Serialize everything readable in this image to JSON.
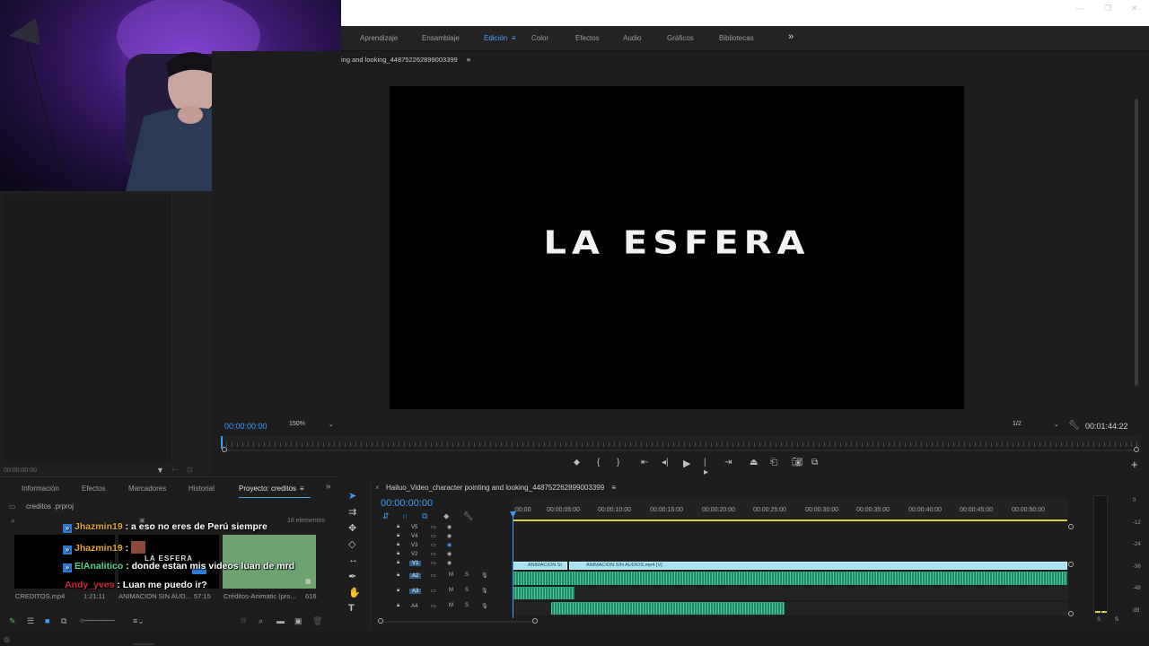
{
  "workspaces": {
    "items": [
      "Aprendizaje",
      "Ensamblaje",
      "Edición",
      "Color",
      "Efectos",
      "Audio",
      "Gráficos",
      "Bibliotecas"
    ],
    "active": "Edición",
    "more": "»"
  },
  "program": {
    "sequence_title": "ing and looking_448752262899003399",
    "menu_icon": "≡",
    "title_text": "LA ESFERA",
    "timecode": "00:00:00:00",
    "zoom": "150%",
    "resolution": "1/2",
    "duration": "00:01:44:22"
  },
  "source": {
    "timecode": "00:00:00:00"
  },
  "project_panel": {
    "tabs": [
      "Información",
      "Efectos",
      "Marcadores",
      "Historial",
      "Proyecto: creditos"
    ],
    "active_tab": "Proyecto: creditos",
    "file": "creditos .prproj",
    "item_count": "18 elementos",
    "items": [
      {
        "name": "CREDITOS.mp4",
        "duration": "1:21:11"
      },
      {
        "name": "ANIMACION SIN AUD...",
        "duration": "57:15"
      },
      {
        "name": "Créditos-Animatic (pro...",
        "duration": "616"
      }
    ],
    "thumb_text": "LA ESFERA"
  },
  "chat": [
    {
      "user": "Jhazmin19",
      "message": "a eso no eres de Perú siempre",
      "color": "#e6a632"
    },
    {
      "user": "Jhazmin19",
      "message": "",
      "color": "#e6a632"
    },
    {
      "user": "ElAnalitico",
      "message": "donde estan mis videos luan de mrd",
      "color": "#5ed18a"
    },
    {
      "user": "Andy_yves",
      "message": "Luan me puedo ir?",
      "color": "#d0283a"
    }
  ],
  "timeline": {
    "sequence_title": "Hailuo_Video_character pointing and looking_448752262899003399",
    "menu_icon": "≡",
    "timecode": "00:00:00:00",
    "ruler_labels": [
      ":00:00",
      "00:00:05:00",
      "00:00:10:00",
      "00:00:15:00",
      "00:00:20:00",
      "00:00:25:00",
      "00:00:30:00",
      "00:00:35:00",
      "00:00:40:00",
      "00:00:45:00",
      "00:00:50:00"
    ],
    "video_tracks": [
      "V5",
      "V4",
      "V3",
      "V2",
      "V1"
    ],
    "audio_tracks": [
      "A2",
      "A3",
      "A4"
    ],
    "clip_names": [
      "ANIMACION SI",
      "ANIMACION SIN AUDIOS.mp4 [V]"
    ]
  },
  "meters": {
    "labels": [
      "0",
      "-12",
      "-24",
      "-36",
      "-48",
      "dB"
    ],
    "solo_labels": [
      "S",
      "S"
    ]
  },
  "colors": {
    "accent": "#3a9cff",
    "video_clip": "#a9e3f2",
    "audio_clip": "#1f8a65",
    "work_area": "#d6cf3a"
  }
}
